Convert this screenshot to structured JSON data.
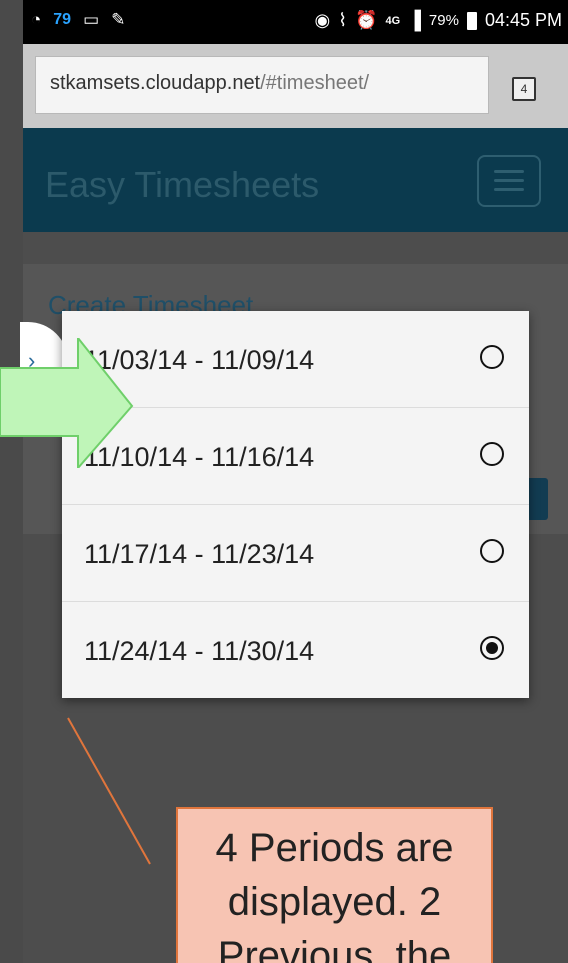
{
  "status_bar": {
    "left_badge": "79",
    "left_icons": [
      "wifi-question-icon",
      "voicemail-icon",
      "pencil-icon"
    ],
    "right_icons": [
      "eye-icon",
      "mute-icon",
      "alarm-icon",
      "signal-icon"
    ],
    "network": "4G",
    "battery_pct": "79%",
    "time": "04:45 PM"
  },
  "browser": {
    "url_host": "stkamsets.cloudapp.net",
    "url_path": "/#timesheet/",
    "tab_count": "4"
  },
  "app": {
    "title": "Easy Timesheets",
    "card_title": "Create Timesheet"
  },
  "periods": [
    {
      "label": "11/03/14 - 11/09/14",
      "selected": false
    },
    {
      "label": "11/10/14 - 11/16/14",
      "selected": false
    },
    {
      "label": "11/17/14 - 11/23/14",
      "selected": false
    },
    {
      "label": "11/24/14 - 11/30/14",
      "selected": true
    }
  ],
  "annotation": {
    "lines": [
      "4 Periods are",
      "displayed. 2",
      "Previous, the"
    ]
  },
  "colors": {
    "header": "#0b3a4e",
    "arrow_fill": "#bff5b8",
    "arrow_stroke": "#6fcf6a",
    "callout_fill": "#f7c4b3",
    "callout_border": "#e0753c"
  }
}
